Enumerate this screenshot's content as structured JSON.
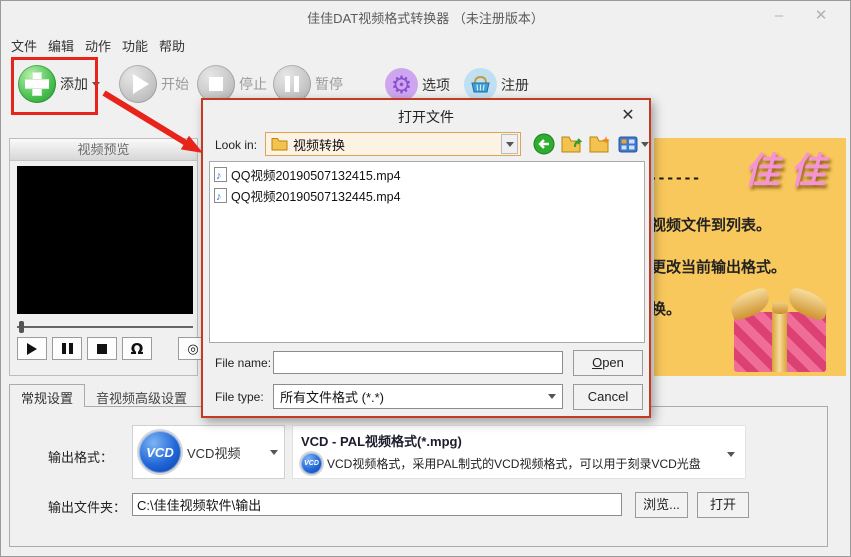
{
  "window": {
    "title": "佳佳DAT视频格式转换器 （未注册版本）",
    "minimize": "–",
    "close": "✕"
  },
  "menu": {
    "items": [
      "文件",
      "编辑",
      "动作",
      "功能",
      "帮助"
    ]
  },
  "toolbar": {
    "add": "添加",
    "start": "开始",
    "stop": "停止",
    "pause": "暂停",
    "options": "选项",
    "register": "注册"
  },
  "preview": {
    "title": "视频预览"
  },
  "banner": {
    "dashes": "------",
    "brand": "佳佳",
    "line1": "视频文件到列表。",
    "line2": "更改当前输出格式。",
    "line3": "换。"
  },
  "tabs": {
    "general": "常规设置",
    "advanced": "音视频高级设置"
  },
  "settings": {
    "output_format_label": "输出格式：",
    "format_combo_icon": "VCD",
    "format_combo_label": "VCD视频",
    "format_title": "VCD - PAL视频格式(*.mpg)",
    "format_icon": "VCD",
    "format_description": "VCD视频格式，采用PAL制式的VCD视频格式，可以用于刻录VCD光盘",
    "output_folder_label": "输出文件夹：",
    "output_folder_value": "C:\\佳佳视频软件\\输出",
    "browse_label": "浏览...",
    "open_label": "打开"
  },
  "dialog": {
    "title": "打开文件",
    "close": "✕",
    "look_in_label": "Look in:",
    "look_in_value": "视频转换",
    "files": [
      {
        "name": "QQ视频20190507132415.mp4"
      },
      {
        "name": "QQ视频20190507132445.mp4"
      }
    ],
    "file_name_label": "File name:",
    "file_name_value": "",
    "file_type_label": "File type:",
    "file_type_value": "所有文件格式 (*.*)",
    "open_label": "Open",
    "cancel_label": "Cancel"
  },
  "colors": {
    "annotation_red": "#e8231a",
    "dialog_border_red": "#c43b23",
    "banner_yellow": "#f8c85c",
    "vcd_blue": "#2166d8",
    "add_green": "#4fc455",
    "options_purple": "#8c4fd0",
    "register_blue": "#bfe0f2"
  }
}
